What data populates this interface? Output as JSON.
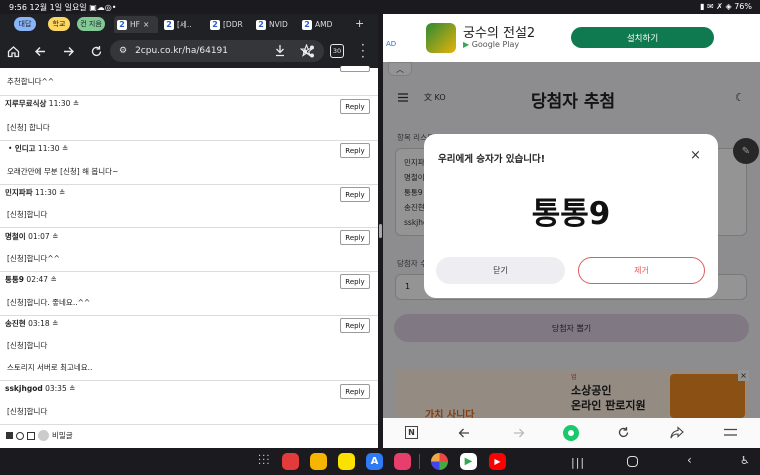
{
  "status": {
    "time": "9:56",
    "date": "12월 1일 일요일",
    "battery": "76%"
  },
  "left_browser": {
    "tab_groups": [
      "대답",
      "학교",
      "컨 지음"
    ],
    "tabs": [
      "HF",
      "[세..",
      "[DDR",
      "NVID",
      "AMD"
    ],
    "url": "2cpu.co.kr/ha/64191",
    "tab_count": "30",
    "comments": [
      {
        "author": "",
        "time": "",
        "text": "추천합니다^^",
        "reply": ""
      },
      {
        "author": "지루무료식상",
        "time": "11:30",
        "text": "[신청] 합니다",
        "reply": "Reply"
      },
      {
        "author": "인디고",
        "time": "11:30",
        "text": "오래간만에 무분 [신청] 해 봅니다~",
        "reply": "Reply"
      },
      {
        "author": "민지파파",
        "time": "11:30",
        "text": "[신청]합니다",
        "reply": "Reply"
      },
      {
        "author": "명철이",
        "time": "01:07",
        "text": "[신청]합니다^^",
        "reply": "Reply"
      },
      {
        "author": "통통9",
        "time": "02:47",
        "text": "[신청]합니다. 좋네요..^^",
        "reply": "Reply"
      },
      {
        "author": "송진현",
        "time": "03:18",
        "text": "[신청]합니다",
        "text2": "스토리지 서버로 최고네요..",
        "reply": "Reply"
      },
      {
        "author": "sskjhgod",
        "time": "03:35",
        "text": "[신청]합니다",
        "reply": "Reply"
      }
    ],
    "secret_label": "비밀글"
  },
  "right_app": {
    "ad": {
      "title": "궁수의 전설2",
      "store": "Google Play",
      "install": "설치하기",
      "ad_tag": "AD"
    },
    "lang": "KO",
    "page_title": "당첨자 추첨",
    "list_label": "항목 리스트",
    "list_items": [
      "민지파",
      "명철이",
      "통통9",
      "송진현",
      "sskjhc"
    ],
    "winners_label": "당첨자 수",
    "winners_value": "1",
    "draw_button": "당첨자 뽑기",
    "banner": {
      "text1": "소상공인",
      "text2": "온라인 판로지원",
      "small": "업",
      "big": "가치 사니다"
    }
  },
  "modal": {
    "title": "우리에게 승자가 있습니다!",
    "winner": "통통9",
    "close": "닫기",
    "remove": "제거"
  },
  "colors": {
    "accent": "#e25b5b",
    "primary_btn": "#ddcfe0",
    "install": "#0f7a4f"
  }
}
